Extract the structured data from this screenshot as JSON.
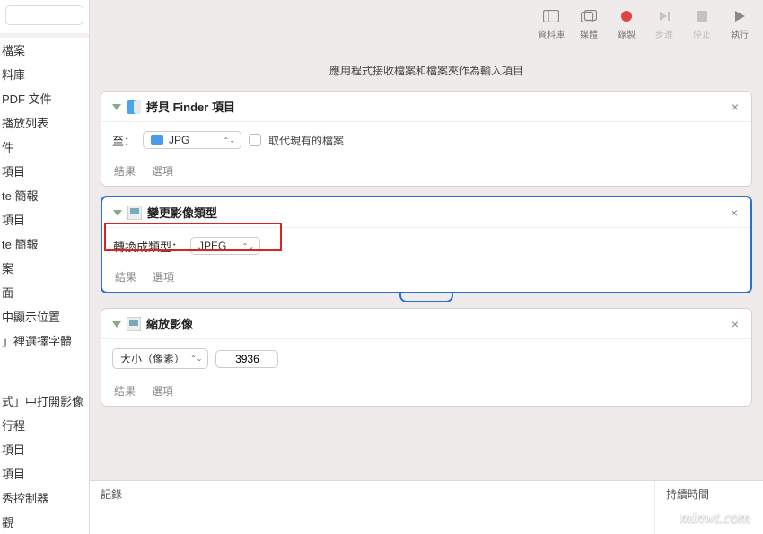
{
  "toolbar": {
    "library": "資料庫",
    "media": "媒體",
    "record": "錄製",
    "step": "步進",
    "stop": "停止",
    "run": "執行"
  },
  "sidebar": {
    "items": [
      "檔案",
      "料庫",
      "PDF 文件",
      "播放列表",
      "件",
      "項目",
      "te 簡報",
      "項目",
      "te 簡報",
      "案",
      "面",
      "中顯示位置",
      "」裡選擇字體",
      "式」中打開影像",
      "行程",
      "項目",
      "項目",
      "秀控制器",
      "觀"
    ]
  },
  "canvas": {
    "input_hint": "應用程式接收檔案和檔案夾作為輸入項目"
  },
  "actions": {
    "copy": {
      "title": "拷貝 Finder 項目",
      "to_label": "至：",
      "folder": "JPG",
      "replace_label": "取代現有的檔案",
      "results": "結果",
      "options": "選項"
    },
    "convert": {
      "title": "變更影像類型",
      "type_label": "轉換成類型：",
      "type_value": "JPEG",
      "results": "結果",
      "options": "選項"
    },
    "scale": {
      "title": "縮放影像",
      "size_mode": "大小（像素）",
      "size_value": "3936",
      "results": "結果",
      "options": "選項"
    }
  },
  "log": {
    "record": "記錄",
    "duration": "持續時間"
  },
  "watermark": "minwt.com"
}
